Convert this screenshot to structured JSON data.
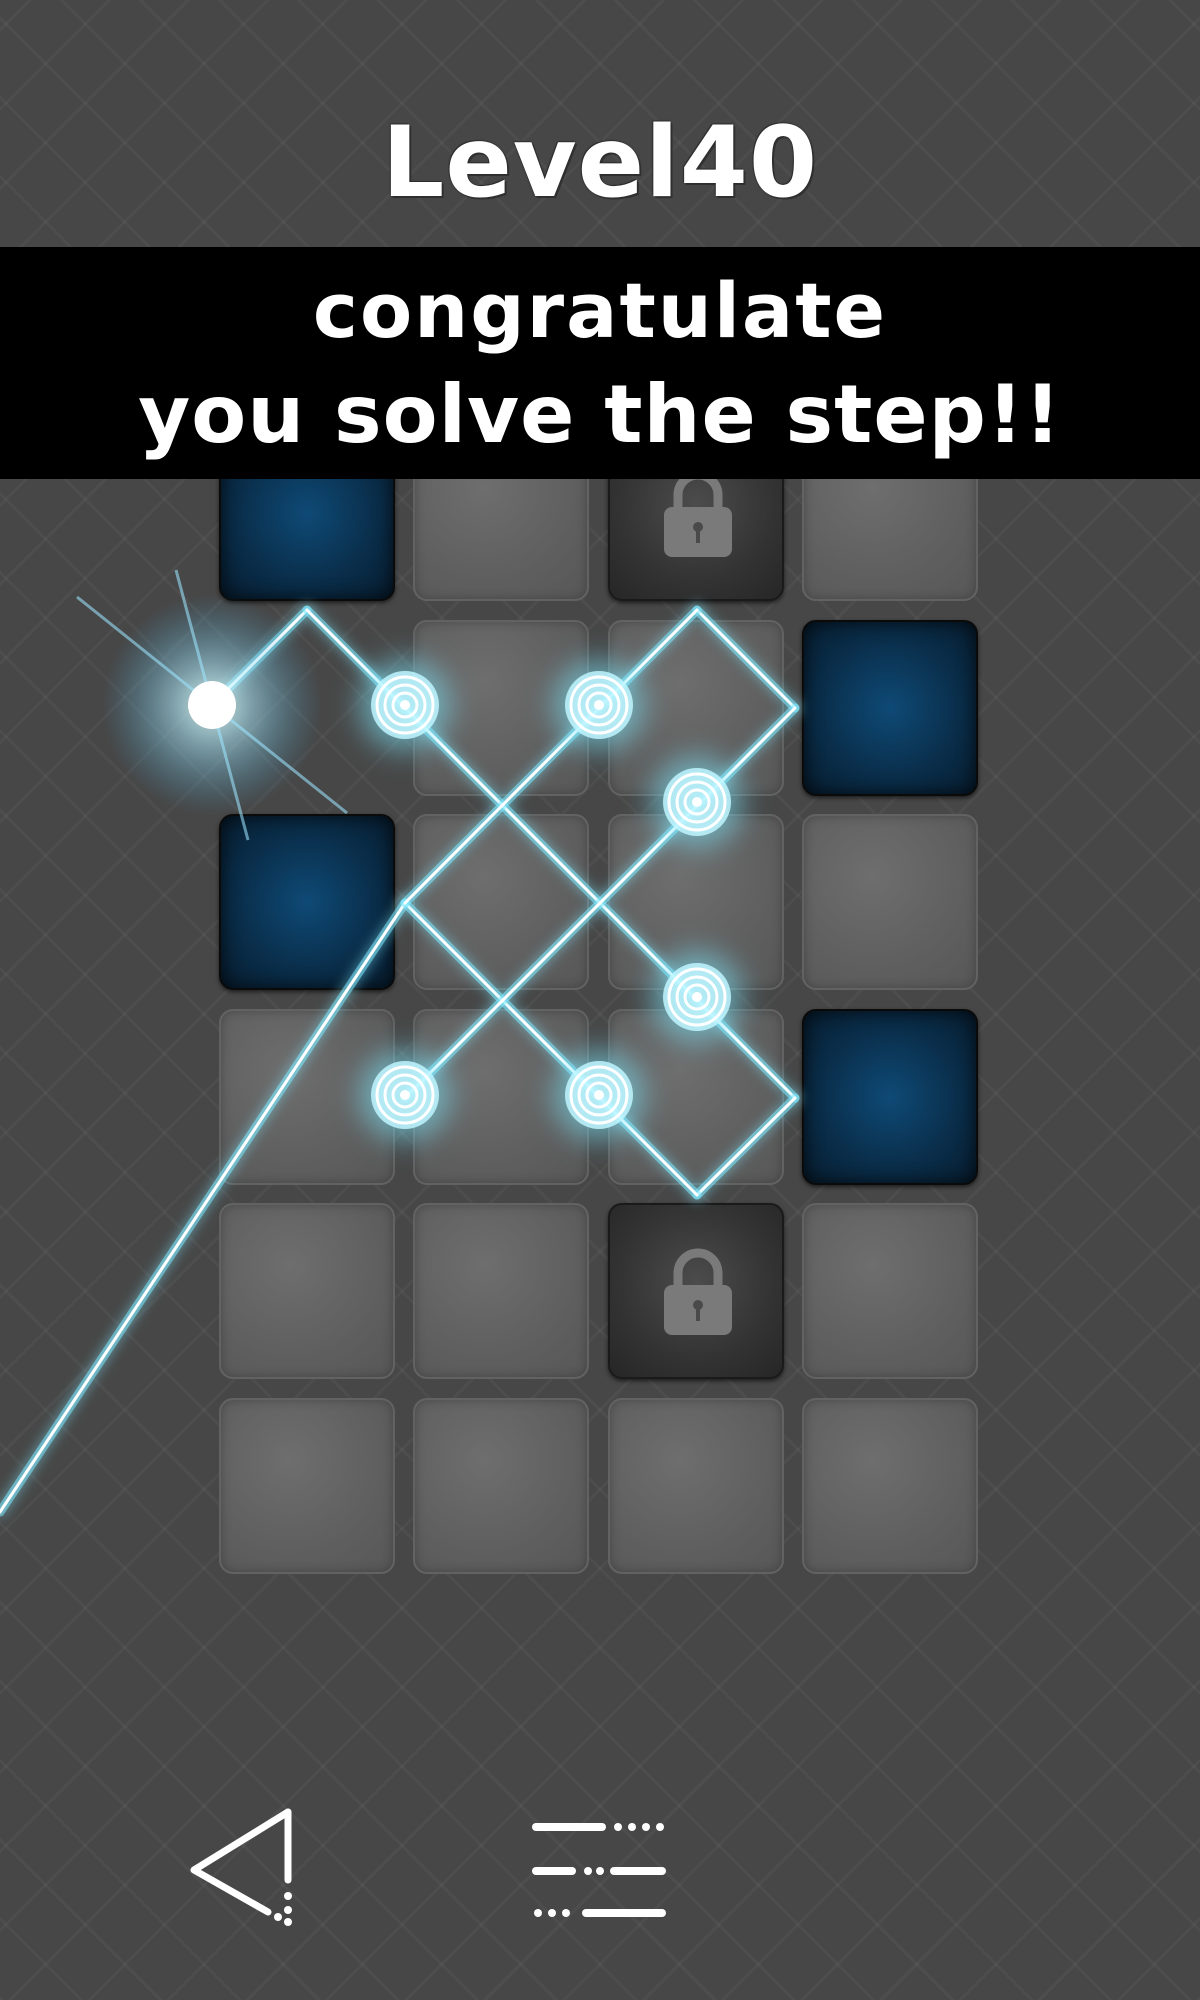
{
  "header": {
    "level_label": "Level40"
  },
  "banner": {
    "line1": "congratulate",
    "line2": "you solve the step!!"
  },
  "board": {
    "rows": [
      [
        "wall",
        "empty",
        "locked",
        "empty"
      ],
      [
        "none",
        "empty",
        "empty",
        "wall"
      ],
      [
        "wall",
        "empty",
        "empty",
        "empty"
      ],
      [
        "empty",
        "empty",
        "empty",
        "wall"
      ],
      [
        "empty",
        "empty",
        "locked",
        "empty"
      ],
      [
        "empty",
        "empty",
        "empty",
        "empty"
      ]
    ],
    "laser_color": "#7fe9ff",
    "wall_color": "#0e4a76"
  },
  "controls": {
    "back_icon": "back-triangle-icon",
    "menu_icon": "level-menu-icon"
  }
}
